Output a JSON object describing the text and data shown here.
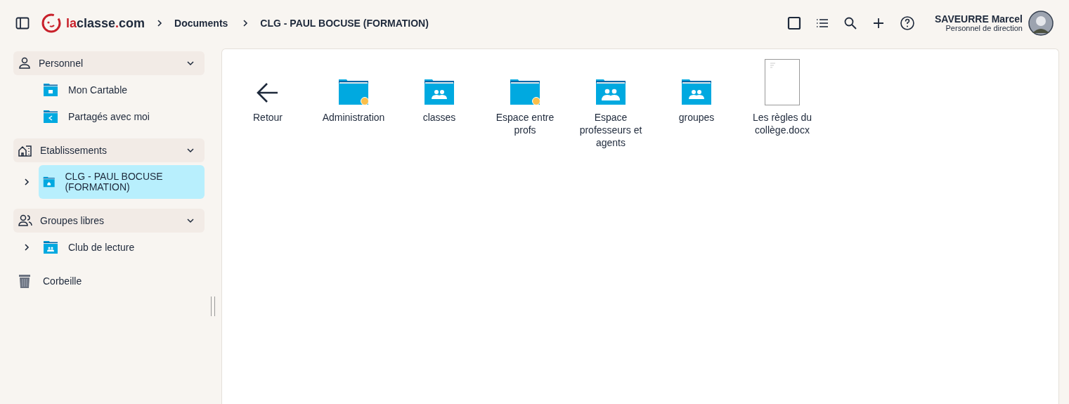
{
  "header": {
    "logo": {
      "accent": "la",
      "main": "classe",
      "dot": ".",
      "tld": "com"
    },
    "breadcrumb": [
      "Documents",
      "CLG - PAUL BOCUSE (FORMATION)"
    ],
    "toolbar": [
      {
        "kind": "square",
        "selected": false
      },
      {
        "kind": "list",
        "selected": false
      },
      {
        "kind": "search",
        "selected": false
      },
      {
        "kind": "add",
        "selected": false
      },
      {
        "kind": "help",
        "selected": false
      }
    ],
    "user": {
      "name": "SAVEURRE Marcel",
      "role": "Personnel de direction"
    }
  },
  "sidebar": {
    "sections": [
      {
        "kind": "person",
        "label": "Personnel",
        "expanded": true,
        "items": [
          {
            "kind": "briefcase",
            "label": "Mon Cartable",
            "has_children": false,
            "selected": false
          },
          {
            "kind": "share",
            "label": "Partagés avec moi",
            "has_children": false,
            "selected": false
          }
        ]
      },
      {
        "kind": "building",
        "label": "Etablissements",
        "expanded": true,
        "items": [
          {
            "kind": "school",
            "label": "CLG - PAUL BOCUSE (FORMATION)",
            "has_children": true,
            "selected": true
          }
        ]
      },
      {
        "kind": "people",
        "label": "Groupes libres",
        "expanded": true,
        "items": [
          {
            "kind": "group",
            "label": "Club de lecture",
            "has_children": true,
            "selected": false
          }
        ]
      }
    ],
    "trash": {
      "label": "Corbeille"
    }
  },
  "files": [
    {
      "kind": "back",
      "label": "Retour",
      "marked": false
    },
    {
      "kind": "folder",
      "label": "Administration",
      "marked": true
    },
    {
      "kind": "group-folder",
      "label": "classes",
      "marked": false
    },
    {
      "kind": "folder",
      "label": "Espace entre profs",
      "marked": true
    },
    {
      "kind": "staff-folder",
      "label": "Espace professeurs et agents",
      "marked": false
    },
    {
      "kind": "group-folder",
      "label": "groupes",
      "marked": false
    },
    {
      "kind": "file",
      "label": "Les règles du collège.docx",
      "marked": false
    }
  ]
}
